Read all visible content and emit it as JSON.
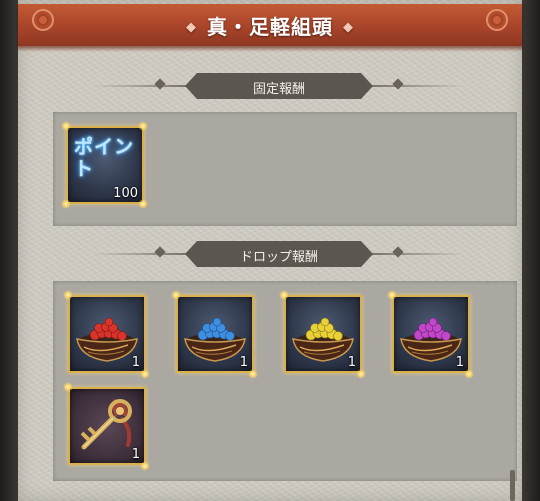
{
  "header": {
    "title": "真・足軽組頭"
  },
  "sections": {
    "fixed": {
      "label": "固定報酬"
    },
    "drop": {
      "label": "ドロップ報酬"
    }
  },
  "fixed_rewards": [
    {
      "icon": "points-icon",
      "label": "ポイント",
      "quantity": "100"
    }
  ],
  "drop_rewards": [
    {
      "icon": "red-orb-bowl-icon",
      "quantity": "1",
      "color": "#d8342c"
    },
    {
      "icon": "blue-orb-bowl-icon",
      "quantity": "1",
      "color": "#3f8fe0"
    },
    {
      "icon": "yellow-orb-bowl-icon",
      "quantity": "1",
      "color": "#e8d038"
    },
    {
      "icon": "purple-orb-bowl-icon",
      "quantity": "1",
      "color": "#c048c8"
    },
    {
      "icon": "golden-key-icon",
      "quantity": "1"
    }
  ],
  "colors": {
    "banner": "#a8442a",
    "item_frame": "#d9b04b",
    "section_plate": "#5c5650"
  }
}
